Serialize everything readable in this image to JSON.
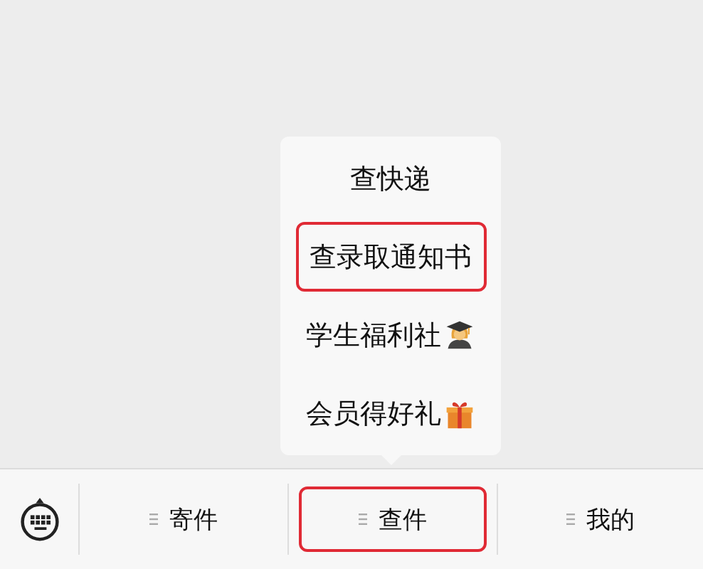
{
  "submenu": {
    "items": [
      {
        "label": "查快递",
        "highlighted": false,
        "kind": "plain"
      },
      {
        "label": "查录取通知书",
        "highlighted": true,
        "kind": "plain"
      },
      {
        "label": "学生福利社",
        "highlighted": false,
        "kind": "student"
      },
      {
        "label": "会员得好礼",
        "highlighted": false,
        "kind": "gift"
      }
    ]
  },
  "menu_bar": {
    "tabs": [
      {
        "label": "寄件",
        "highlighted": false
      },
      {
        "label": "查件",
        "highlighted": true
      },
      {
        "label": "我的",
        "highlighted": false
      }
    ]
  }
}
